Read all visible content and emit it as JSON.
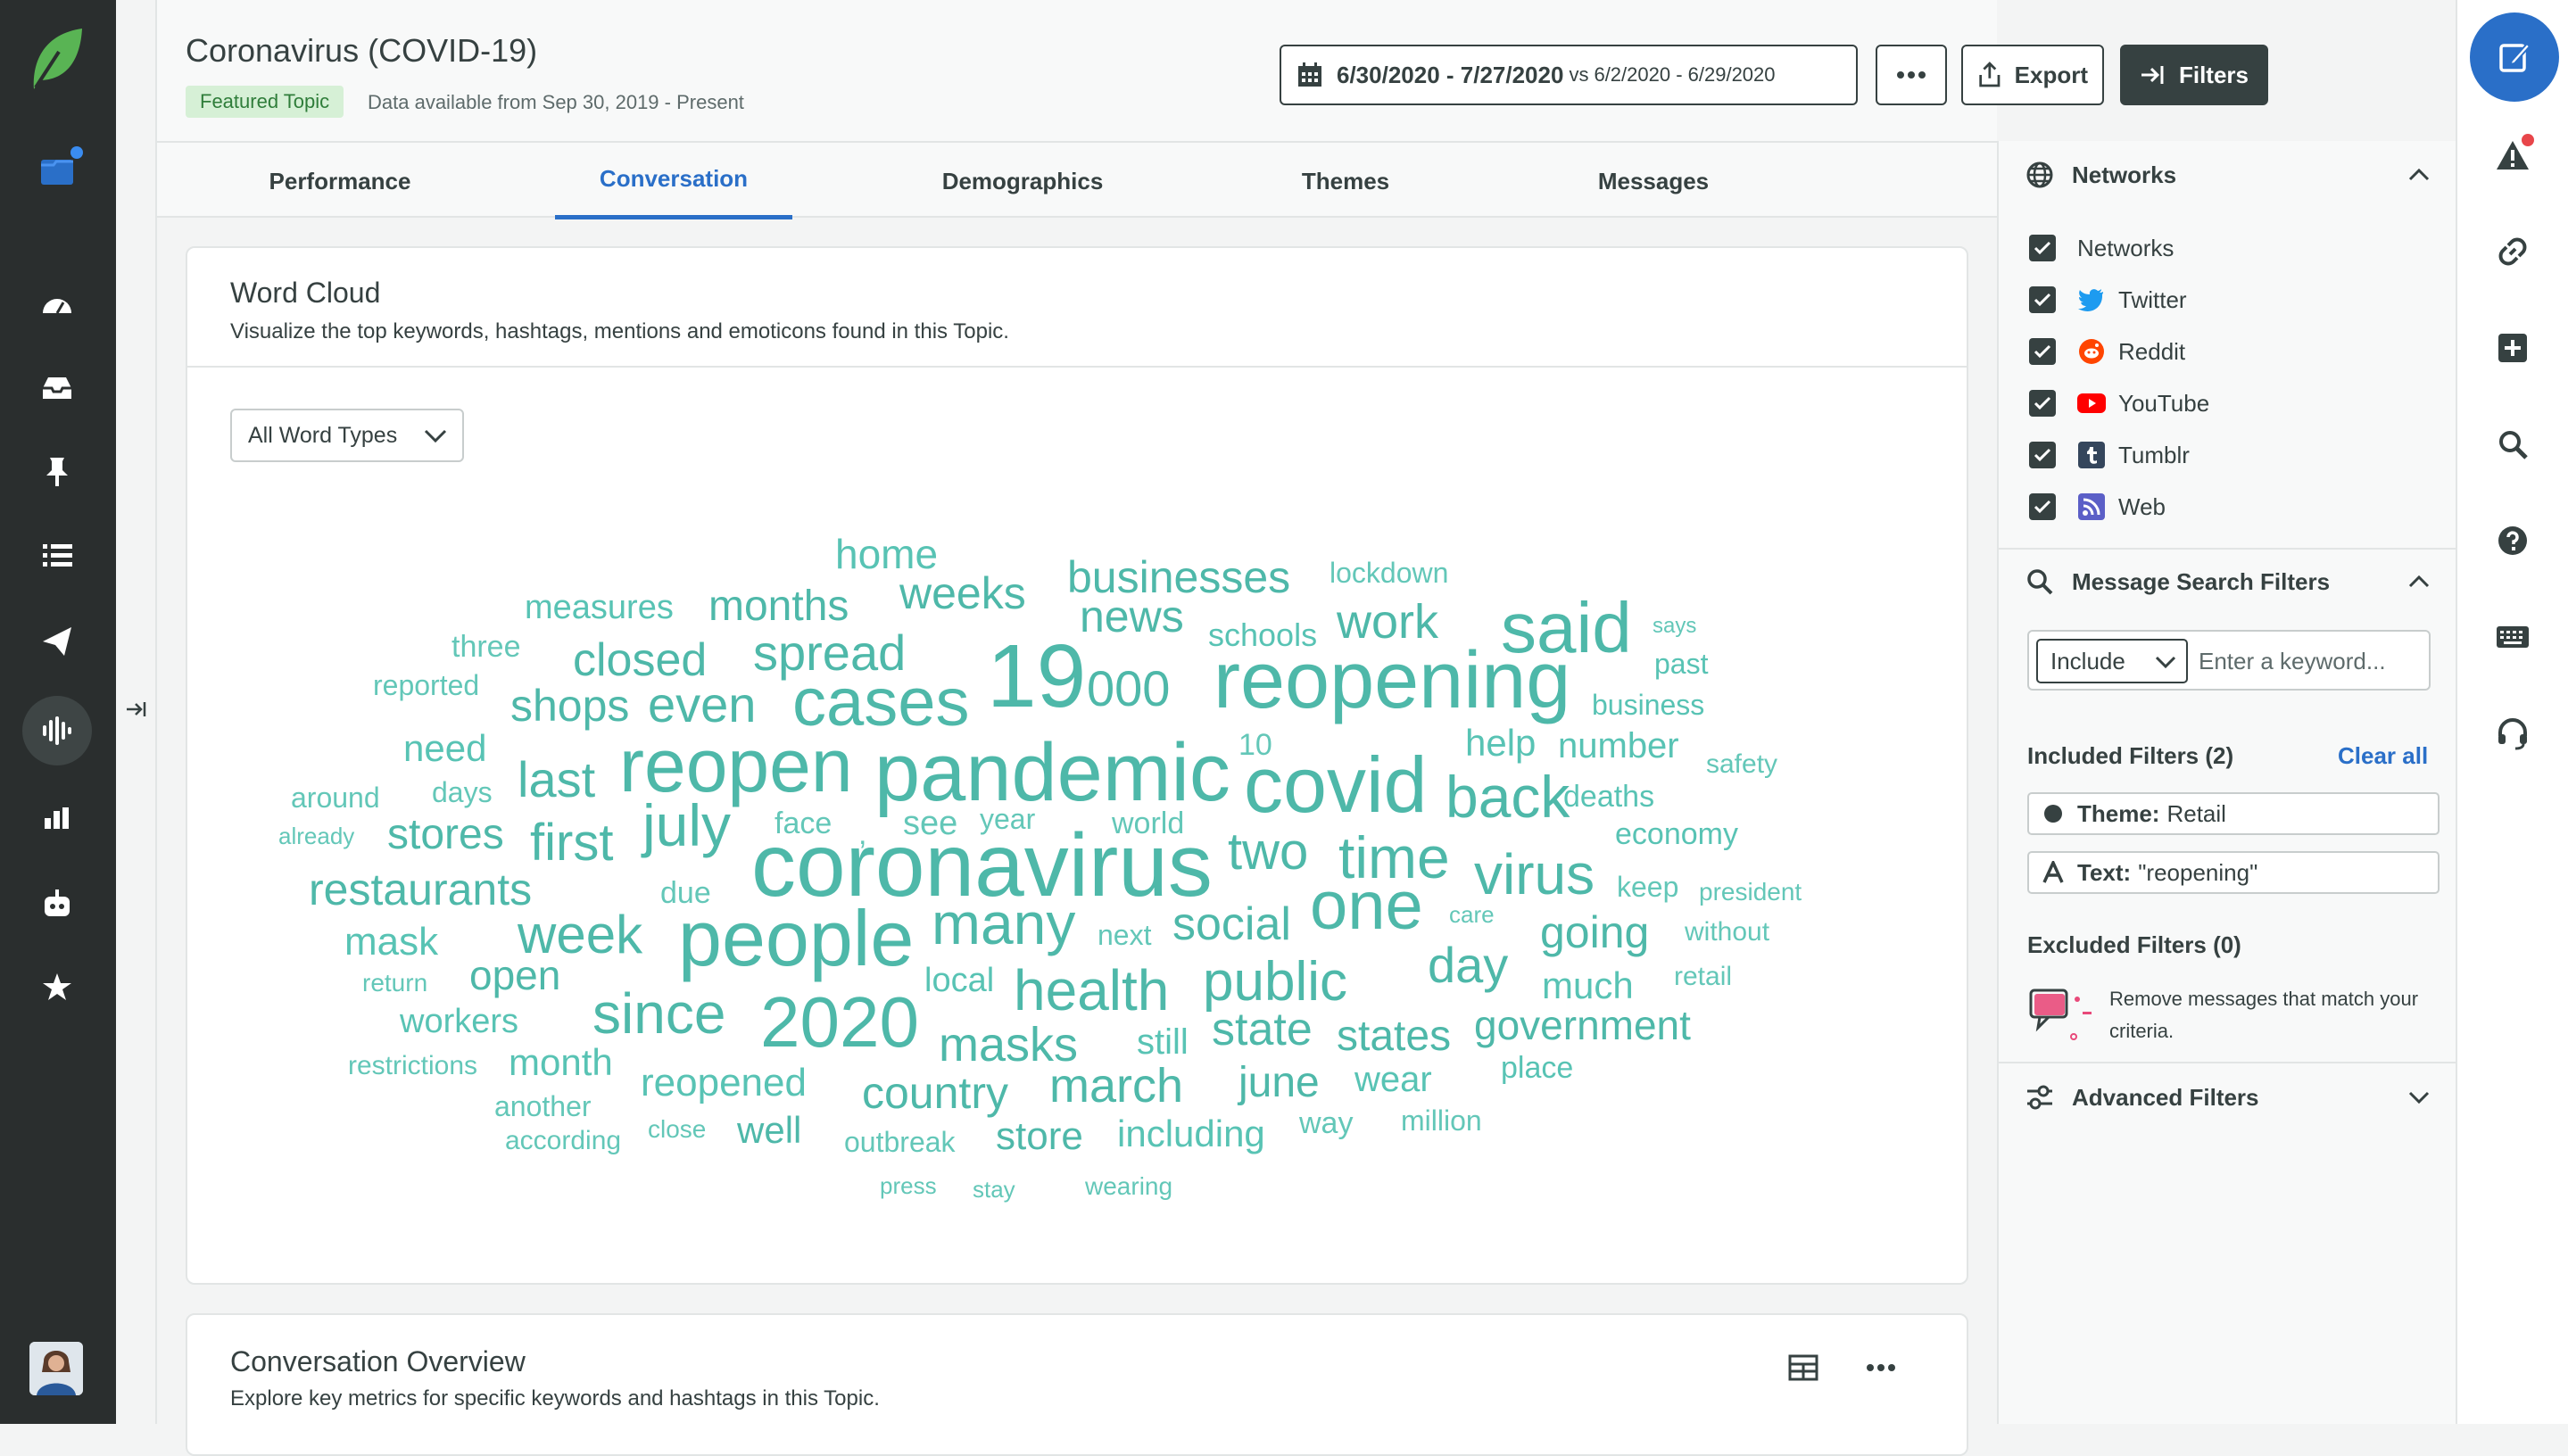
{
  "header": {
    "title": "Coronavirus (COVID-19)",
    "badge": "Featured Topic",
    "data_available": "Data available from Sep 30, 2019 - Present",
    "date_range": "6/30/2020 - 7/27/2020",
    "vs_label": "vs",
    "compare_range": "6/2/2020 - 6/29/2020",
    "more_label": "•••",
    "export_label": "Export",
    "filters_label": "Filters"
  },
  "tabs": [
    {
      "label": "Performance"
    },
    {
      "label": "Conversation",
      "active": true
    },
    {
      "label": "Demographics"
    },
    {
      "label": "Themes"
    },
    {
      "label": "Messages"
    }
  ],
  "word_cloud_card": {
    "title": "Word Cloud",
    "subtitle": "Visualize the top keywords, hashtags, mentions and emoticons found in this Topic.",
    "word_type_select": "All Word Types",
    "words": [
      {
        "t": "coronavirus",
        "w": 9,
        "c": "#4eb8a9"
      },
      {
        "t": "pandemic",
        "w": 8,
        "c": "#4eb8a9"
      },
      {
        "t": "reopening",
        "w": 8,
        "c": "#4eb8a9"
      },
      {
        "t": "19",
        "w": 9,
        "c": "#4eb8a9"
      },
      {
        "t": "covid",
        "w": 8,
        "c": "#4eb8a9"
      },
      {
        "t": "people",
        "w": 8,
        "c": "#4eb8a9"
      },
      {
        "t": "reopen",
        "w": 8,
        "c": "#4eb8a9"
      },
      {
        "t": "cases",
        "w": 7,
        "c": "#4eb8a9"
      },
      {
        "t": "said",
        "w": 7,
        "c": "#4eb8a9"
      },
      {
        "t": "2020",
        "w": 7,
        "c": "#4eb8a9"
      },
      {
        "t": "one",
        "w": 7,
        "c": "#4eb8a9"
      },
      {
        "t": "back",
        "w": 6,
        "c": "#4eb8a9"
      },
      {
        "t": "july",
        "w": 6,
        "c": "#4eb8a9"
      },
      {
        "t": "many",
        "w": 6,
        "c": "#4eb8a9"
      },
      {
        "t": "time",
        "w": 6,
        "c": "#4eb8a9"
      },
      {
        "t": "virus",
        "w": 6,
        "c": "#4eb8a9"
      },
      {
        "t": "since",
        "w": 6,
        "c": "#4eb8a9"
      },
      {
        "t": "health",
        "w": 6,
        "c": "#4eb8a9"
      },
      {
        "t": "public",
        "w": 6,
        "c": "#4eb8a9"
      },
      {
        "t": "week",
        "w": 6,
        "c": "#4eb8a9"
      },
      {
        "t": "two",
        "w": 5,
        "c": "#4eb8a9"
      },
      {
        "t": "first",
        "w": 5,
        "c": "#4eb8a9"
      },
      {
        "t": "last",
        "w": 5,
        "c": "#4eb8a9"
      },
      {
        "t": "even",
        "w": 5,
        "c": "#4eb8a9"
      },
      {
        "t": "000",
        "w": 5,
        "c": "#4eb8a9"
      },
      {
        "t": "spread",
        "w": 5,
        "c": "#4eb8a9"
      },
      {
        "t": "closed",
        "w": 5,
        "c": "#4eb8a9"
      },
      {
        "t": "shops",
        "w": 5,
        "c": "#4eb8a9"
      },
      {
        "t": "social",
        "w": 5,
        "c": "#4eb8a9"
      },
      {
        "t": "day",
        "w": 5,
        "c": "#4eb8a9"
      },
      {
        "t": "work",
        "w": 5,
        "c": "#4eb8a9"
      },
      {
        "t": "news",
        "w": 5,
        "c": "#4eb8a9"
      },
      {
        "t": "businesses",
        "w": 5,
        "c": "#4eb8a9"
      },
      {
        "t": "weeks",
        "w": 5,
        "c": "#4eb8a9"
      },
      {
        "t": "months",
        "w": 5,
        "c": "#4eb8a9"
      },
      {
        "t": "home",
        "w": 5,
        "c": "#58c3b4"
      },
      {
        "t": "restaurants",
        "w": 5,
        "c": "#4eb8a9"
      },
      {
        "t": "stores",
        "w": 5,
        "c": "#4eb8a9"
      },
      {
        "t": "going",
        "w": 5,
        "c": "#4eb8a9"
      },
      {
        "t": "state",
        "w": 5,
        "c": "#4eb8a9"
      },
      {
        "t": "states",
        "w": 5,
        "c": "#4eb8a9"
      },
      {
        "t": "government",
        "w": 5,
        "c": "#4eb8a9"
      },
      {
        "t": "masks",
        "w": 5,
        "c": "#4eb8a9"
      },
      {
        "t": "march",
        "w": 5,
        "c": "#4eb8a9"
      },
      {
        "t": "june",
        "w": 5,
        "c": "#4eb8a9"
      },
      {
        "t": "country",
        "w": 5,
        "c": "#4eb8a9"
      },
      {
        "t": "open",
        "w": 5,
        "c": "#4eb8a9"
      },
      {
        "t": "mask",
        "w": 5,
        "c": "#58c3b4"
      },
      {
        "t": "month",
        "w": 4,
        "c": "#58c3b4"
      },
      {
        "t": "reopened",
        "w": 4,
        "c": "#58c3b4"
      },
      {
        "t": "store",
        "w": 4,
        "c": "#4eb8a9"
      },
      {
        "t": "including",
        "w": 4,
        "c": "#58c3b4"
      },
      {
        "t": "well",
        "w": 4,
        "c": "#4eb8a9"
      },
      {
        "t": "much",
        "w": 4,
        "c": "#58c3b4"
      },
      {
        "t": "help",
        "w": 4,
        "c": "#58c3b4"
      },
      {
        "t": "number",
        "w": 4,
        "c": "#58c3b4"
      },
      {
        "t": "workers",
        "w": 4,
        "c": "#58c3b4"
      },
      {
        "t": "need",
        "w": 4,
        "c": "#58c3b4"
      },
      {
        "t": "measures",
        "w": 4,
        "c": "#58c3b4"
      },
      {
        "t": "wear",
        "w": 4,
        "c": "#58c3b4"
      },
      {
        "t": "place",
        "w": 3,
        "c": "#58c3b4"
      },
      {
        "t": "still",
        "w": 4,
        "c": "#58c3b4"
      },
      {
        "t": "local",
        "w": 4,
        "c": "#58c3b4"
      },
      {
        "t": "economy",
        "w": 3,
        "c": "#58c3b4"
      },
      {
        "t": "deaths",
        "w": 3,
        "c": "#58c3b4"
      },
      {
        "t": "business",
        "w": 3,
        "c": "#58c3b4"
      },
      {
        "t": "past",
        "w": 3,
        "c": "#58c3b4"
      },
      {
        "t": "schools",
        "w": 3,
        "c": "#58c3b4"
      },
      {
        "t": "lockdown",
        "w": 3,
        "c": "#63c7b8"
      },
      {
        "t": "three",
        "w": 3,
        "c": "#63c7b8"
      },
      {
        "t": "reported",
        "w": 3,
        "c": "#63c7b8"
      },
      {
        "t": "around",
        "w": 3,
        "c": "#63c7b8"
      },
      {
        "t": "days",
        "w": 3,
        "c": "#63c7b8"
      },
      {
        "t": "face",
        "w": 3,
        "c": "#63c7b8"
      },
      {
        "t": "see",
        "w": 3,
        "c": "#63c7b8"
      },
      {
        "t": "year",
        "w": 3,
        "c": "#63c7b8"
      },
      {
        "t": "world",
        "w": 3,
        "c": "#63c7b8"
      },
      {
        "t": "10",
        "w": 3,
        "c": "#63c7b8"
      },
      {
        "t": "safety",
        "w": 3,
        "c": "#63c7b8"
      },
      {
        "t": "keep",
        "w": 3,
        "c": "#63c7b8"
      },
      {
        "t": "president",
        "w": 3,
        "c": "#63c7b8"
      },
      {
        "t": "without",
        "w": 3,
        "c": "#63c7b8"
      },
      {
        "t": "retail",
        "w": 3,
        "c": "#63c7b8"
      },
      {
        "t": "next",
        "w": 3,
        "c": "#63c7b8"
      },
      {
        "t": "care",
        "w": 2,
        "c": "#63c7b8"
      },
      {
        "t": "due",
        "w": 3,
        "c": "#63c7b8"
      },
      {
        "t": "return",
        "w": 2,
        "c": "#63c7b8"
      },
      {
        "t": "restrictions",
        "w": 3,
        "c": "#63c7b8"
      },
      {
        "t": "another",
        "w": 3,
        "c": "#63c7b8"
      },
      {
        "t": "according",
        "w": 3,
        "c": "#63c7b8"
      },
      {
        "t": "close",
        "w": 3,
        "c": "#63c7b8"
      },
      {
        "t": "outbreak",
        "w": 3,
        "c": "#63c7b8"
      },
      {
        "t": "way",
        "w": 3,
        "c": "#63c7b8"
      },
      {
        "t": "million",
        "w": 3,
        "c": "#63c7b8"
      },
      {
        "t": "press",
        "w": 2,
        "c": "#63c7b8"
      },
      {
        "t": "stay",
        "w": 2,
        "c": "#63c7b8"
      },
      {
        "t": "wearing",
        "w": 3,
        "c": "#63c7b8"
      },
      {
        "t": "says",
        "w": 2,
        "c": "#63c7b8"
      },
      {
        "t": "already",
        "w": 2,
        "c": "#63c7b8"
      },
      {
        "t": ",",
        "w": 3,
        "c": "#63c7b8"
      }
    ]
  },
  "overview_card": {
    "title": "Conversation Overview",
    "subtitle": "Explore key metrics for specific keywords and hashtags in this Topic.",
    "more_label": "•••"
  },
  "filters_panel": {
    "networks_heading": "Networks",
    "networks": [
      {
        "label": "Networks",
        "icon": "none"
      },
      {
        "label": "Twitter",
        "icon": "twitter-icon"
      },
      {
        "label": "Reddit",
        "icon": "reddit-icon"
      },
      {
        "label": "YouTube",
        "icon": "youtube-icon"
      },
      {
        "label": "Tumblr",
        "icon": "tumblr-icon"
      },
      {
        "label": "Web",
        "icon": "rss-icon"
      }
    ],
    "message_search_heading": "Message Search Filters",
    "include_select": "Include",
    "keyword_placeholder": "Enter a keyword...",
    "included_heading": "Included Filters (2)",
    "clear_all": "Clear all",
    "included": [
      {
        "key": "Theme:",
        "value": "Retail"
      },
      {
        "key": "Text:",
        "value": "\"reopening\""
      }
    ],
    "excluded_heading": "Excluded Filters (0)",
    "excluded_note": "Remove messages that match your criteria.",
    "advanced_heading": "Advanced Filters"
  },
  "colors": {
    "accent": "#2a6fc8",
    "nav_bg": "#2a2e2e",
    "word": "#58c3b4",
    "brand_green": "#59b454"
  }
}
